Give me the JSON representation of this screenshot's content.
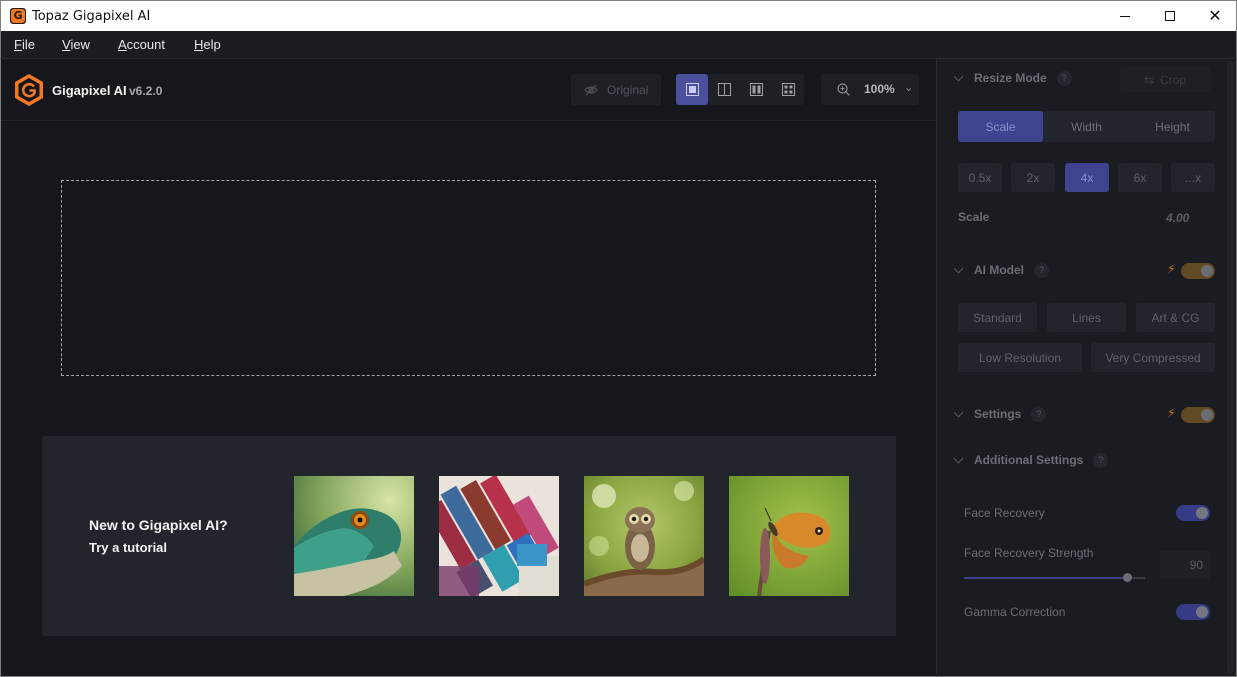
{
  "window": {
    "title": "Topaz Gigapixel AI"
  },
  "menu": [
    {
      "key": "F",
      "rest": "ile"
    },
    {
      "key": "V",
      "rest": "iew"
    },
    {
      "key": "A",
      "rest": "ccount"
    },
    {
      "key": "H",
      "rest": "elp"
    }
  ],
  "brand": {
    "name": "Gigapixel AI",
    "version": "v6.2.0"
  },
  "toolbar": {
    "original_label": "Original",
    "zoom": "100%",
    "view_modes": [
      "single",
      "split",
      "side-by-side",
      "grid"
    ],
    "active_view_mode": "single"
  },
  "tutorial": {
    "title": "New to Gigapixel AI?",
    "subtitle": "Try a tutorial",
    "samples": [
      "lizard",
      "paint-brushes",
      "owl",
      "butterfly"
    ]
  },
  "resize_mode": {
    "title": "Resize Mode",
    "help": "?",
    "crop_label": "Crop",
    "tabs": [
      "Scale",
      "Width",
      "Height"
    ],
    "active_tab": "Scale",
    "scale_options": [
      "0.5x",
      "2x",
      "4x",
      "6x",
      "...x"
    ],
    "active_scale": "4x",
    "scale_label": "Scale",
    "scale_value": "4.00"
  },
  "ai_model": {
    "title": "AI Model",
    "help": "?",
    "options_row1": [
      "Standard",
      "Lines",
      "Art & CG"
    ],
    "options_row2": [
      "Low Resolution",
      "Very Compressed"
    ]
  },
  "settings": {
    "title": "Settings",
    "help": "?"
  },
  "additional_settings": {
    "title": "Additional Settings",
    "help": "?",
    "face_recovery_label": "Face Recovery",
    "face_recovery_strength_label": "Face Recovery Strength",
    "face_recovery_strength": "90",
    "face_recovery_strength_level": 0.9,
    "gamma_correction_label": "Gamma Correction"
  },
  "colors": {
    "accent": "#4b4f9c",
    "brand_orange": "#f07822",
    "background": "#16171d",
    "panel": "#1b1c22"
  }
}
